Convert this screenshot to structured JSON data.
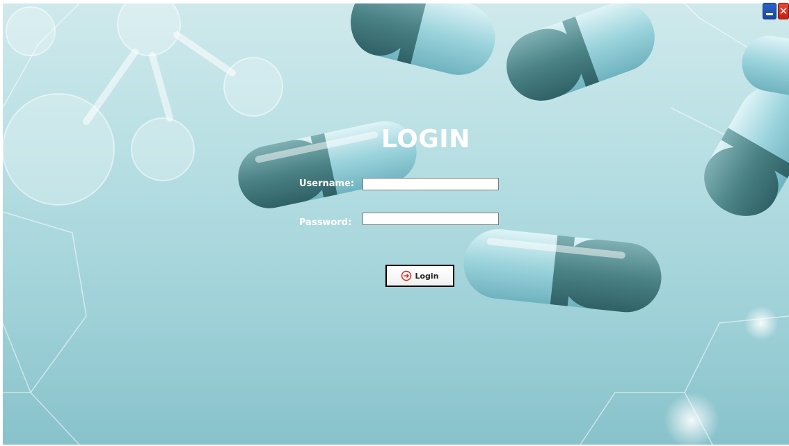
{
  "window": {
    "minimize_icon": "minimize-icon",
    "close_icon": "close-icon",
    "close_glyph": "✕"
  },
  "login": {
    "title": "LOGIN",
    "username_label": "Username:",
    "username_value": "",
    "password_label": "Password:",
    "password_value": "",
    "button_label": "Login",
    "button_icon": "login-arrow-icon"
  },
  "colors": {
    "background": "#9fd1d8",
    "text": "#ffffff",
    "button_icon": "#d62718"
  }
}
